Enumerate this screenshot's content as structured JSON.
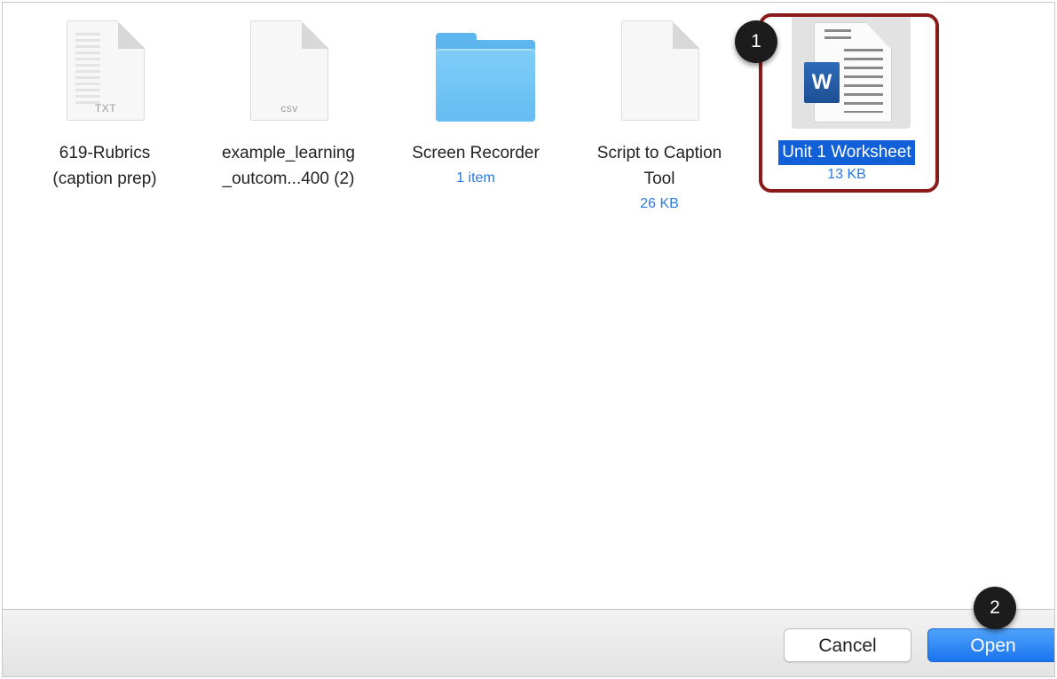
{
  "files": [
    {
      "name": "619-Rubrics\n(caption prep)",
      "type": "txt",
      "icon": "txt-file-icon",
      "label": "TXT"
    },
    {
      "name": "example_learning\n_outcom...400 (2)",
      "type": "csv",
      "icon": "csv-file-icon",
      "label": "csv"
    },
    {
      "name": "Screen Recorder",
      "type": "folder",
      "icon": "folder-icon",
      "meta": "1 item"
    },
    {
      "name": "Script to Caption\nTool",
      "type": "document",
      "icon": "document-icon",
      "meta": "26 KB"
    },
    {
      "name": "Unit 1 Worksheet",
      "type": "word",
      "icon": "word-document-icon",
      "badge": "W",
      "meta": "13 KB",
      "selected": true
    }
  ],
  "callouts": {
    "first": "1",
    "second": "2"
  },
  "buttons": {
    "cancel": "Cancel",
    "open": "Open"
  },
  "colors": {
    "selection": "#1160d8",
    "highlight_border": "#8b1a1a",
    "primary_button": "#1a74ef",
    "meta_text": "#2a7ae2"
  }
}
